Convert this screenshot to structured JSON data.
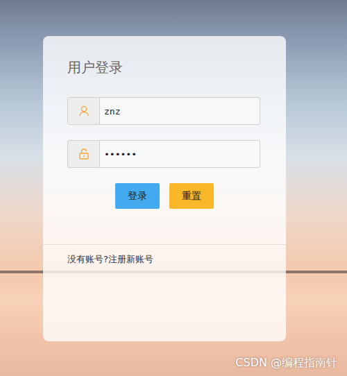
{
  "title": "用户登录",
  "fields": [
    {
      "value": "znz"
    },
    {
      "value": "••••••"
    }
  ],
  "buttons": [
    {
      "label": "登录",
      "color": "#44aaf0"
    },
    {
      "label": "重置",
      "color": "#f9b72a"
    }
  ],
  "register_link": "没有账号?注册新账号",
  "watermark": "CSDN @编程指南针"
}
